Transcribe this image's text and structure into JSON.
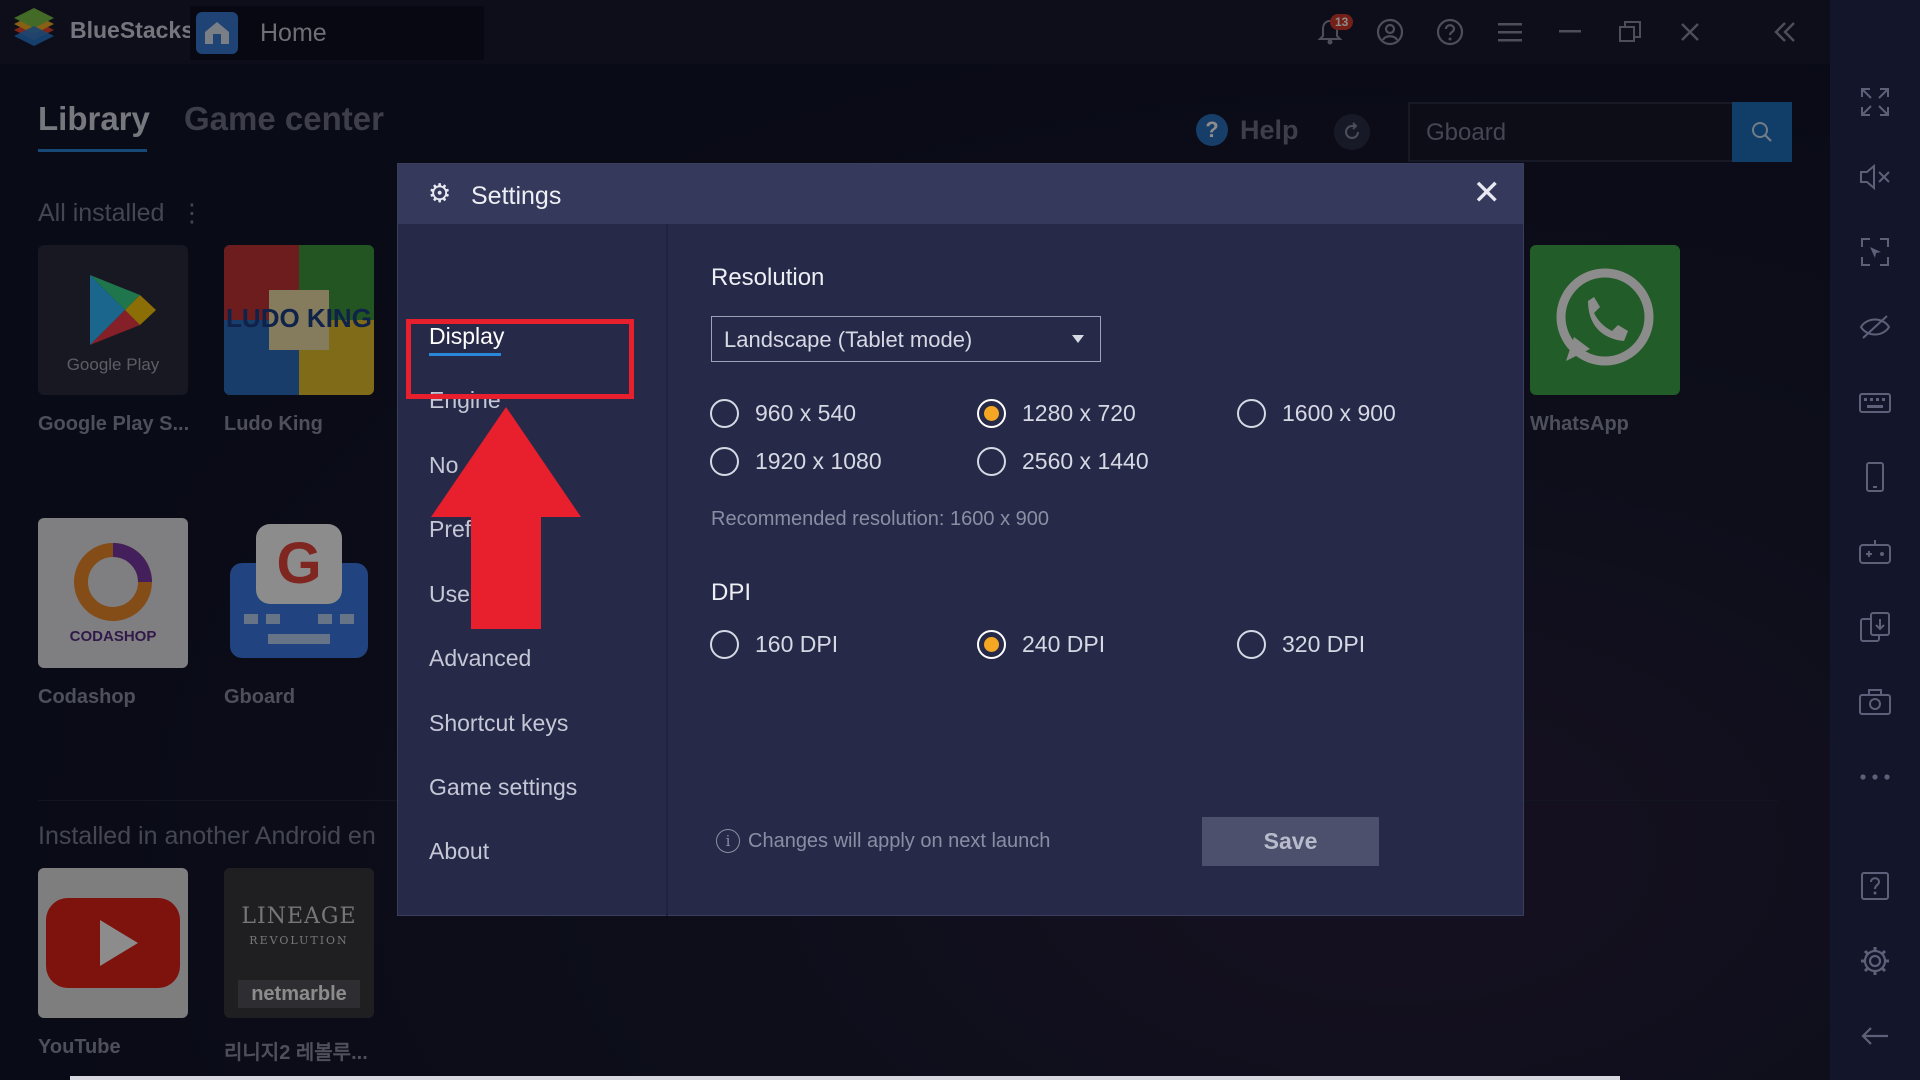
{
  "app": {
    "name": "BlueStacks"
  },
  "window": {
    "tab_title": "Home",
    "notification_count": "13"
  },
  "titlebar_icons": [
    "bell-icon",
    "account-icon",
    "help-icon",
    "menu-icon",
    "minimize-icon",
    "restore-icon",
    "close-icon",
    "collapse-sidebar-icon"
  ],
  "library": {
    "tabs": [
      "Library",
      "Game center"
    ],
    "help_label": "Help",
    "search_value": "Gboard",
    "all_installed_label": "All installed",
    "apps": [
      {
        "name": "Google Play S...",
        "icon_text": "Google Play"
      },
      {
        "name": "Ludo King",
        "icon_text": "LUDO KING"
      },
      {
        "name": "WhatsApp"
      },
      {
        "name": "Codashop",
        "icon_text": "CODASHOP"
      },
      {
        "name": "Gboard",
        "icon_text": "G"
      }
    ],
    "other_android_label": "Installed in another Android en",
    "other_apps": [
      {
        "name": "YouTube"
      },
      {
        "name": "리니지2 레볼루...",
        "icon_text_1": "LINEAGE",
        "icon_text_2": "REVOLUTION",
        "icon_text_3": "netmarble"
      }
    ]
  },
  "settings": {
    "title": "Settings",
    "nav": [
      "Display",
      "Engine",
      "Notifications",
      "Preferences",
      "User data",
      "Advanced",
      "Shortcut keys",
      "Game settings",
      "About"
    ],
    "nav_visible": [
      "Display",
      "Engine",
      "No",
      "Pref",
      "Use",
      "Advanced",
      "Shortcut keys",
      "Game settings",
      "About"
    ],
    "active_nav": "Display",
    "resolution": {
      "label": "Resolution",
      "mode": "Landscape (Tablet mode)",
      "options": [
        "960 x 540",
        "1280 x 720",
        "1600 x 900",
        "1920 x 1080",
        "2560 x 1440"
      ],
      "selected": "1280 x 720",
      "recommended": "Recommended resolution: 1600 x 900"
    },
    "dpi": {
      "label": "DPI",
      "options": [
        "160 DPI",
        "240 DPI",
        "320 DPI"
      ],
      "selected": "240 DPI"
    },
    "footnote": "Changes will apply on next launch",
    "save_label": "Save"
  },
  "colors": {
    "accent": "#2a86d8",
    "radio_selected": "#f5a623",
    "highlight": "#e81f2d"
  }
}
